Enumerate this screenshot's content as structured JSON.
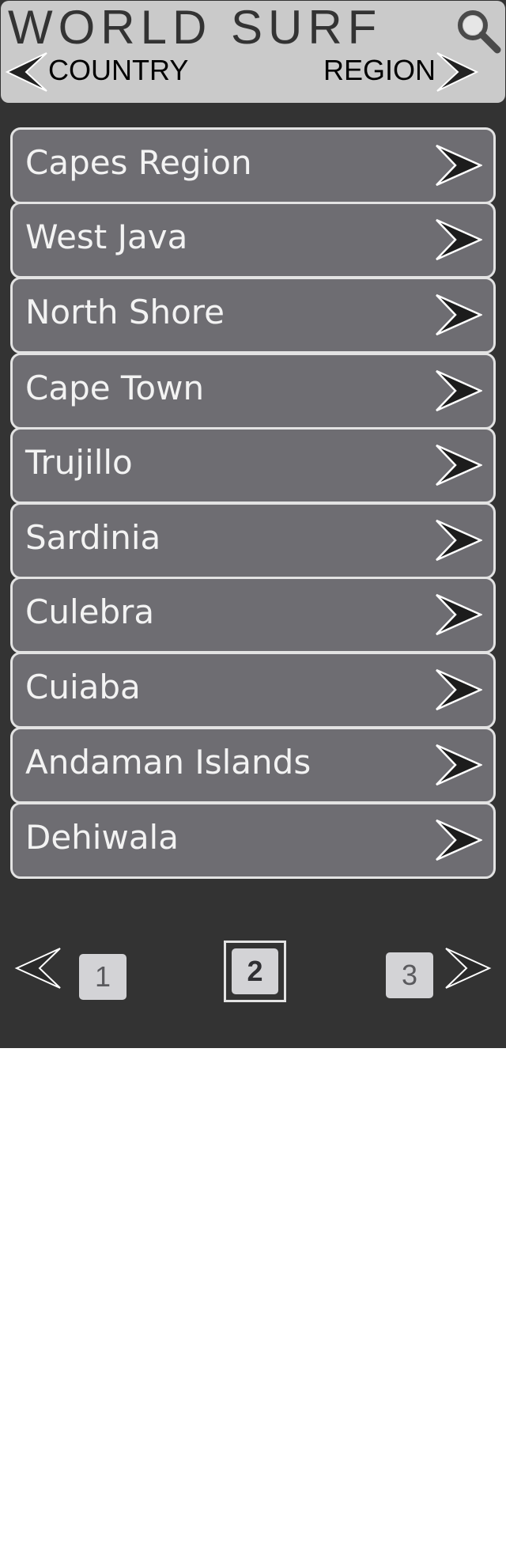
{
  "app": {
    "title": "WORLD SURF"
  },
  "header": {
    "search_icon": "search-icon",
    "prev_label": "COUNTRY",
    "next_label": "REGION"
  },
  "regions": [
    "Capes Region",
    "West Java",
    "North Shore",
    "Cape Town",
    "Trujillo",
    "Sardinia",
    "Culebra",
    "Cuiaba",
    "Andaman Islands",
    "Dehiwala"
  ],
  "pagination": {
    "pages": [
      "1",
      "2",
      "3"
    ],
    "current": "2"
  },
  "colors": {
    "background": "#333333",
    "header": "#cacaca",
    "list_item": "#6e6d72",
    "list_border": "#e3e3e3",
    "page_button": "#d3d3d6"
  }
}
